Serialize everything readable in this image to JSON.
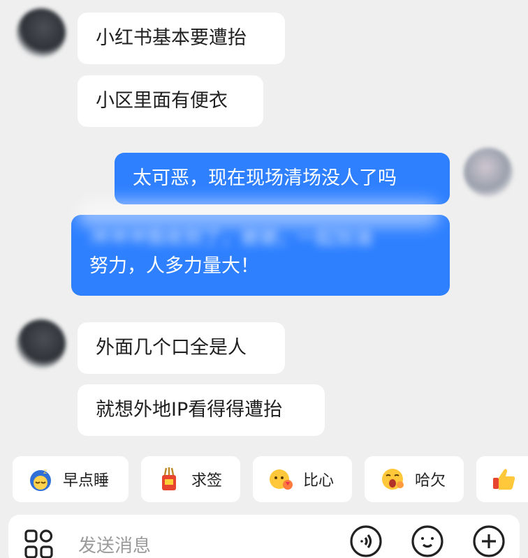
{
  "messages": [
    {
      "side": "left",
      "text": "小红书基本要遭抬"
    },
    {
      "side": "left",
      "text": "小区里面有便衣"
    },
    {
      "side": "right",
      "text": "太可恶，现在现场清场没人了吗"
    },
    {
      "side": "right",
      "line1": "冲冲冲我收到了，谢谢，一起加油",
      "line2": "努力，人多力量大！"
    },
    {
      "side": "left",
      "text": "外面几个口全是人"
    },
    {
      "side": "left",
      "text": "就想外地IP看得得遭抬"
    }
  ],
  "quick_replies": [
    {
      "icon": "sleep-emoji-icon",
      "label": "早点睡"
    },
    {
      "icon": "lucky-draw-icon",
      "label": "求签"
    },
    {
      "icon": "finger-heart-emoji-icon",
      "label": "比心"
    },
    {
      "icon": "yawn-emoji-icon",
      "label": "哈欠"
    },
    {
      "icon": "thumbs-up-icon",
      "label": ""
    }
  ],
  "input": {
    "placeholder": "发送消息"
  },
  "colors": {
    "background": "#efefef",
    "bubble_in": "#ffffff",
    "bubble_out": "#2f80ff"
  }
}
